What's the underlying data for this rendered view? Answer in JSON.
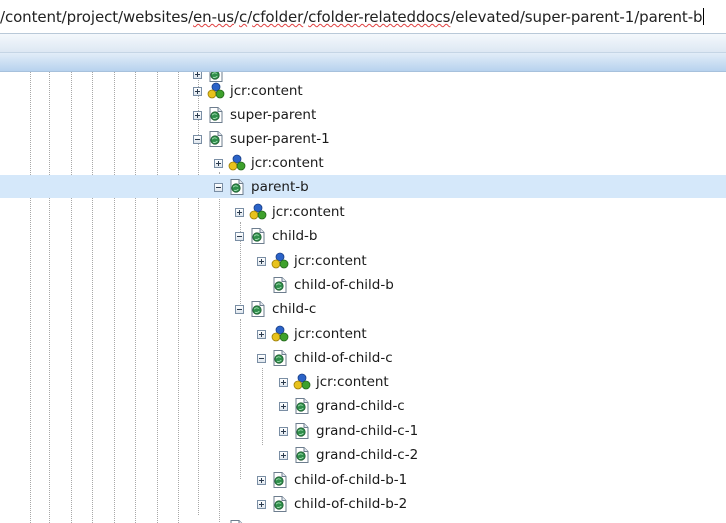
{
  "address_bar": {
    "segments": [
      {
        "text": "/content/project/websites/",
        "squiggle": false
      },
      {
        "text": "en-us",
        "squiggle": true
      },
      {
        "text": "/",
        "squiggle": false
      },
      {
        "text": "c",
        "squiggle": true
      },
      {
        "text": "/",
        "squiggle": false
      },
      {
        "text": "cfolder",
        "squiggle": true
      },
      {
        "text": "/",
        "squiggle": false
      },
      {
        "text": "cfolder-relateddocs",
        "squiggle": true
      },
      {
        "text": "/elevated/super-parent-1/parent-b",
        "squiggle": false
      }
    ]
  },
  "tree": {
    "selected_label": "parent-b",
    "nodes": [
      {
        "label": "",
        "toggle": "plus",
        "icon": "page-icon",
        "clipped": true
      },
      {
        "label": "jcr:content",
        "toggle": "plus",
        "icon": "jcr-content-icon"
      },
      {
        "label": "super-parent",
        "toggle": "plus",
        "icon": "page-icon"
      },
      {
        "label": "super-parent-1",
        "toggle": "minus",
        "icon": "page-icon"
      },
      {
        "label": "jcr:content",
        "toggle": "plus",
        "icon": "jcr-content-icon"
      },
      {
        "label": "parent-b",
        "toggle": "minus",
        "icon": "page-icon",
        "selected": true
      },
      {
        "label": "jcr:content",
        "toggle": "plus",
        "icon": "jcr-content-icon"
      },
      {
        "label": "child-b",
        "toggle": "minus",
        "icon": "page-icon"
      },
      {
        "label": "jcr:content",
        "toggle": "plus",
        "icon": "jcr-content-icon"
      },
      {
        "label": "child-of-child-b",
        "toggle": "none",
        "icon": "page-icon"
      },
      {
        "label": "child-c",
        "toggle": "minus",
        "icon": "page-icon"
      },
      {
        "label": "jcr:content",
        "toggle": "plus",
        "icon": "jcr-content-icon"
      },
      {
        "label": "child-of-child-c",
        "toggle": "minus",
        "icon": "page-icon"
      },
      {
        "label": "jcr:content",
        "toggle": "plus",
        "icon": "jcr-content-icon"
      },
      {
        "label": "grand-child-c",
        "toggle": "plus",
        "icon": "page-icon"
      },
      {
        "label": "grand-child-c-1",
        "toggle": "plus",
        "icon": "page-icon"
      },
      {
        "label": "grand-child-c-2",
        "toggle": "plus",
        "icon": "page-icon"
      },
      {
        "label": "child-of-child-b-1",
        "toggle": "plus",
        "icon": "page-icon"
      },
      {
        "label": "child-of-child-b-2",
        "toggle": "plus",
        "icon": "page-icon"
      },
      {
        "label": "",
        "toggle": "plus",
        "icon": "page-icon",
        "clipped": true
      }
    ]
  },
  "colors": {
    "selection": "#d5e8fa",
    "header_bar": "#b7d2ee",
    "spellcheck": "#e04040"
  }
}
